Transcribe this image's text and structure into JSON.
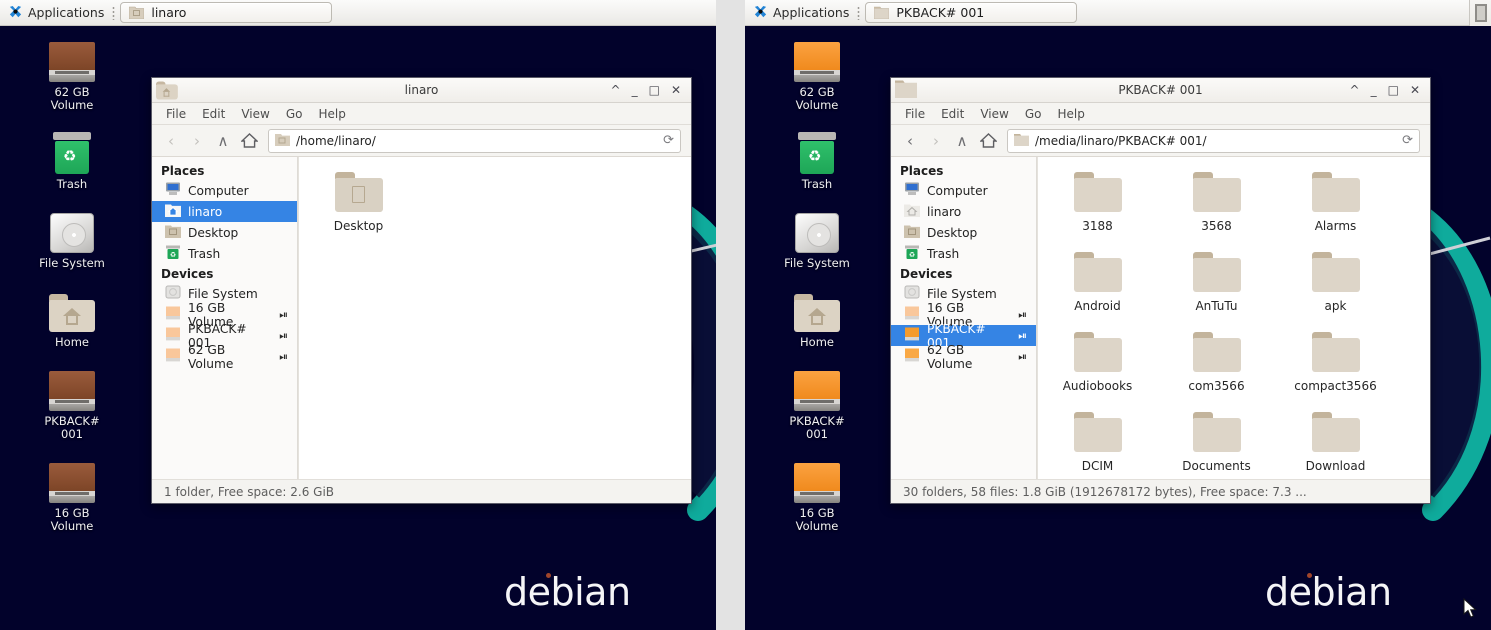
{
  "desktop": {
    "wallpaper_word": "debian",
    "background_color": "#02022b",
    "accent_color": "#0fab9c"
  },
  "panels": [
    {
      "id": "left",
      "taskbar": {
        "applications_label": "Applications",
        "task_button_label": "linaro",
        "apps_icon": "xfce-mouse-icon",
        "task_icon": "home-folder-icon"
      },
      "desktop_icons": [
        {
          "label": "62 GB\nVolume",
          "label_line1": "62 GB",
          "label_line2": "Volume",
          "icon": "drive-icon",
          "icon_color": "#7d4527"
        },
        {
          "label": "Trash",
          "label_line1": "Trash",
          "label_line2": "",
          "icon": "trash-icon",
          "icon_color": "#1ea657"
        },
        {
          "label": "File System",
          "label_line1": "File System",
          "label_line2": "",
          "icon": "harddisk-icon",
          "icon_color": "#d5d4d2"
        },
        {
          "label": "Home",
          "label_line1": "Home",
          "label_line2": "",
          "icon": "home-folder-icon",
          "icon_color": "#dcd3c4"
        },
        {
          "label": "PKBACK#\n001",
          "label_line1": "PKBACK#",
          "label_line2": "001",
          "icon": "drive-icon",
          "icon_color": "#7d4527"
        },
        {
          "label": "16 GB\nVolume",
          "label_line1": "16 GB",
          "label_line2": "Volume",
          "icon": "drive-icon",
          "icon_color": "#7d4527"
        }
      ],
      "window": {
        "title": "linaro",
        "icon": "home-folder-icon",
        "controls": {
          "shade": "^",
          "minimize": "_",
          "maximize": "□",
          "close": "✕"
        },
        "menu": [
          "File",
          "Edit",
          "View",
          "Go",
          "Help"
        ],
        "path": "/home/linaro/",
        "path_icon": "home-folder-icon",
        "reload_icon": "reload-icon",
        "nav": {
          "back": "‹",
          "forward": "›",
          "up": "∧",
          "home": "home-icon"
        },
        "sidebar": {
          "places_header": "Places",
          "places": [
            {
              "label": "Computer",
              "icon": "computer-icon",
              "selected": false,
              "eject": false
            },
            {
              "label": "linaro",
              "icon": "home-icon",
              "selected": true,
              "eject": false
            },
            {
              "label": "Desktop",
              "icon": "desktop-folder-icon",
              "selected": false,
              "eject": false
            },
            {
              "label": "Trash",
              "icon": "trash-icon",
              "selected": false,
              "eject": false
            }
          ],
          "devices_header": "Devices",
          "devices": [
            {
              "label": "File System",
              "icon": "harddisk-icon",
              "selected": false,
              "eject": false
            },
            {
              "label": "16 GB Volume",
              "icon": "volume-icon",
              "selected": false,
              "eject": true
            },
            {
              "label": "PKBACK# 001",
              "icon": "volume-icon",
              "selected": false,
              "eject": true
            },
            {
              "label": "62 GB Volume",
              "icon": "volume-icon",
              "selected": false,
              "eject": true
            }
          ]
        },
        "items": [
          {
            "label": "Desktop",
            "icon": "desktop-folder-icon"
          }
        ],
        "statusbar": "1 folder, Free space: 2.6 GiB"
      }
    },
    {
      "id": "right",
      "taskbar": {
        "applications_label": "Applications",
        "task_button_label": "PKBACK# 001",
        "apps_icon": "xfce-mouse-icon",
        "task_icon": "folder-icon"
      },
      "desktop_icons": [
        {
          "label_line1": "62 GB",
          "label_line2": "Volume",
          "icon": "drive-icon",
          "icon_color": "#f08a1d"
        },
        {
          "label_line1": "Trash",
          "label_line2": "",
          "icon": "trash-icon",
          "icon_color": "#1ea657"
        },
        {
          "label_line1": "File System",
          "label_line2": "",
          "icon": "harddisk-icon",
          "icon_color": "#d5d4d2"
        },
        {
          "label_line1": "Home",
          "label_line2": "",
          "icon": "home-folder-icon",
          "icon_color": "#dcd3c4"
        },
        {
          "label_line1": "PKBACK#",
          "label_line2": "001",
          "icon": "drive-icon",
          "icon_color": "#f08a1d"
        },
        {
          "label_line1": "16 GB",
          "label_line2": "Volume",
          "icon": "drive-icon",
          "icon_color": "#f08a1d"
        }
      ],
      "window": {
        "title": "PKBACK# 001",
        "icon": "folder-icon",
        "controls": {
          "shade": "^",
          "minimize": "_",
          "maximize": "□",
          "close": "✕"
        },
        "menu": [
          "File",
          "Edit",
          "View",
          "Go",
          "Help"
        ],
        "path": "/media/linaro/PKBACK# 001/",
        "path_icon": "folder-icon",
        "reload_icon": "reload-icon",
        "nav": {
          "back": "‹",
          "forward": "›",
          "up": "∧",
          "home": "home-icon"
        },
        "sidebar": {
          "places_header": "Places",
          "places": [
            {
              "label": "Computer",
              "icon": "computer-icon",
              "selected": false,
              "eject": false
            },
            {
              "label": "linaro",
              "icon": "home-icon",
              "selected": false,
              "eject": false
            },
            {
              "label": "Desktop",
              "icon": "desktop-folder-icon",
              "selected": false,
              "eject": false
            },
            {
              "label": "Trash",
              "icon": "trash-icon",
              "selected": false,
              "eject": false
            }
          ],
          "devices_header": "Devices",
          "devices": [
            {
              "label": "File System",
              "icon": "harddisk-icon",
              "selected": false,
              "eject": false
            },
            {
              "label": "16 GB Volume",
              "icon": "volume-icon",
              "selected": false,
              "eject": true
            },
            {
              "label": "PKBACK# 001",
              "icon": "volume-icon",
              "selected": true,
              "eject": true
            },
            {
              "label": "62 GB Volume",
              "icon": "volume-icon",
              "selected": false,
              "eject": true
            }
          ]
        },
        "items": [
          {
            "label": "3188",
            "icon": "folder-icon"
          },
          {
            "label": "3568",
            "icon": "folder-icon"
          },
          {
            "label": "Alarms",
            "icon": "folder-icon"
          },
          {
            "label": "Android",
            "icon": "folder-icon"
          },
          {
            "label": "AnTuTu",
            "icon": "folder-icon"
          },
          {
            "label": "apk",
            "icon": "folder-icon"
          },
          {
            "label": "Audiobooks",
            "icon": "folder-icon"
          },
          {
            "label": "com3566",
            "icon": "folder-icon"
          },
          {
            "label": "compact3566",
            "icon": "folder-icon"
          },
          {
            "label": "DCIM",
            "icon": "folder-icon"
          },
          {
            "label": "Documents",
            "icon": "folder-icon"
          },
          {
            "label": "Download",
            "icon": "folder-icon"
          }
        ],
        "statusbar": "30 folders, 58 files: 1.8 GiB (1912678172 bytes), Free space: 7.3 ..."
      }
    }
  ]
}
